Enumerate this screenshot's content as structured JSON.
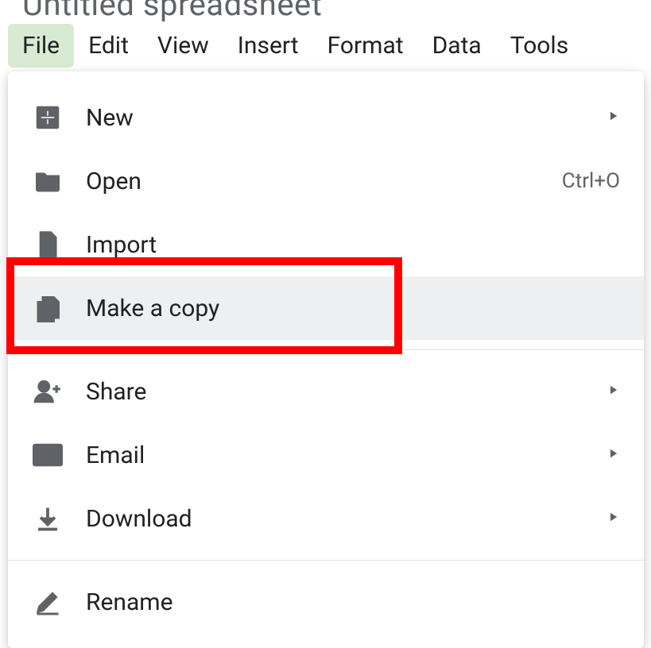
{
  "title": "Untitled spreadsheet",
  "menubar": {
    "file": "File",
    "edit": "Edit",
    "view": "View",
    "insert": "Insert",
    "format": "Format",
    "data": "Data",
    "tools": "Tools"
  },
  "menu": {
    "new": {
      "label": "New"
    },
    "open": {
      "label": "Open",
      "shortcut": "Ctrl+O"
    },
    "import": {
      "label": "Import"
    },
    "make_copy": {
      "label": "Make a copy"
    },
    "share": {
      "label": "Share"
    },
    "email": {
      "label": "Email"
    },
    "download": {
      "label": "Download"
    },
    "rename": {
      "label": "Rename"
    }
  }
}
